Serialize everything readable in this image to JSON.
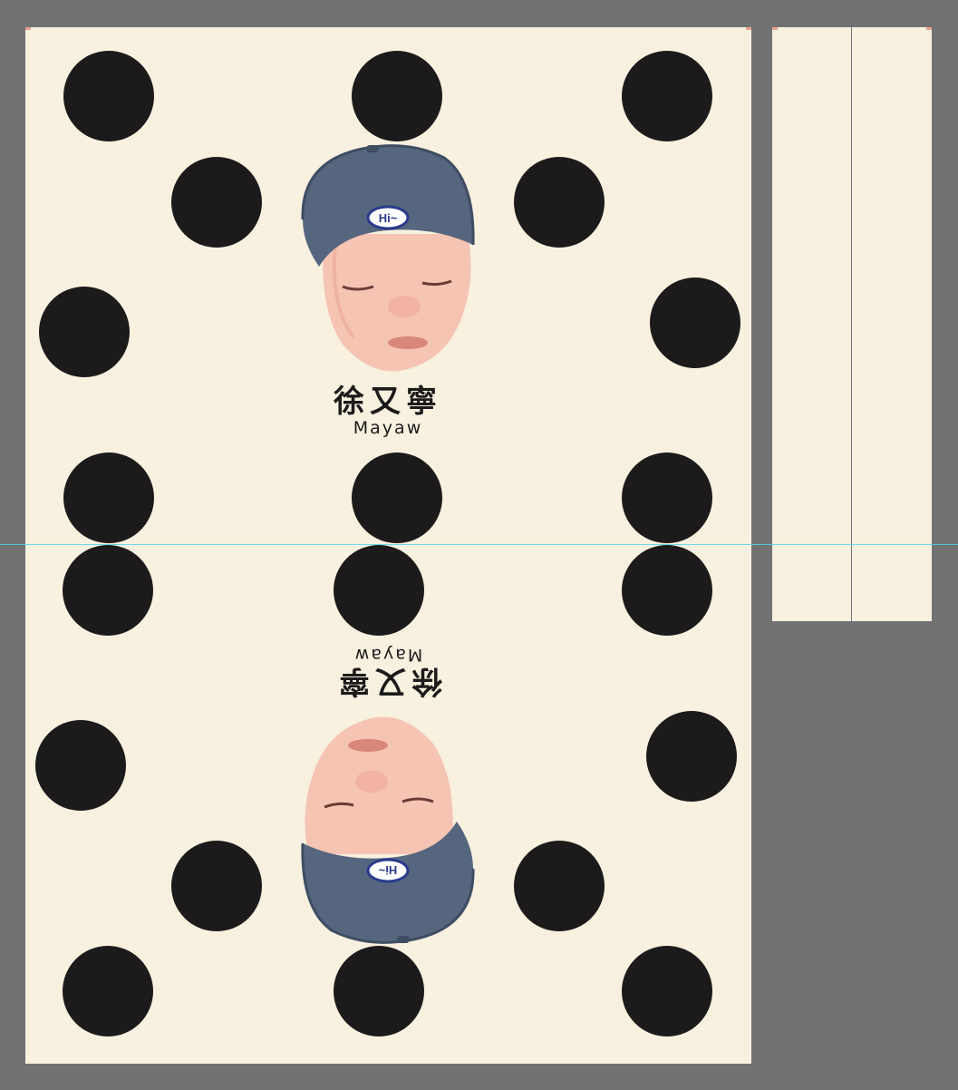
{
  "artboard": {
    "background": "#f8f1e0",
    "workspace_color": "#727272",
    "dot_color": "#1c1a1a",
    "guide_color": "#4fd6e6"
  },
  "design": {
    "name_chinese": "徐又寧",
    "name_english": "Mayaw",
    "hat_badge_text": "Hi~"
  }
}
